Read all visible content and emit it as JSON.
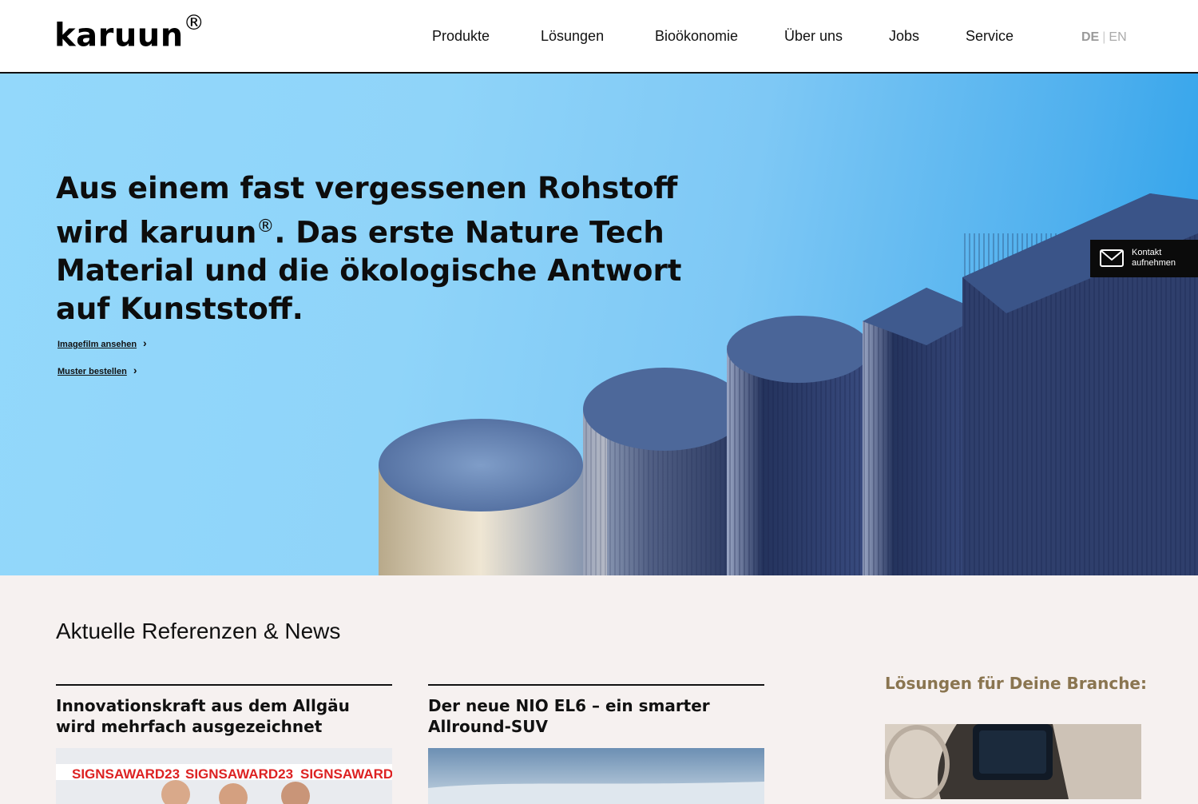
{
  "header": {
    "logo": "karuun",
    "logo_mark": "®",
    "nav": [
      "Produkte",
      "Lösungen",
      "Bioökonomie",
      "Über uns",
      "Jobs",
      "Service"
    ],
    "lang_active": "DE",
    "lang_sep": "|",
    "lang_other": "EN"
  },
  "hero": {
    "title_part1": "Aus einem fast vergessenen Rohstoff wird karuun",
    "title_mark": "®",
    "title_part2": ". Das erste Nature Tech Material und die ökologische Antwort auf Kunststoff.",
    "link1": "Imagefilm ansehen",
    "link2": "Muster bestellen",
    "contact_line1": "Kontakt",
    "contact_line2": "aufnehmen"
  },
  "news": {
    "title": "Aktuelle Referenzen & News",
    "cards": [
      {
        "title": "Innovationskraft aus dem Allgäu wird mehrfach ausgezeichnet",
        "award_text": "SIGNSAWARD23"
      },
      {
        "title": "Der neue NIO EL6 – ein smarter Allround-SUV"
      }
    ],
    "branch_title": "Lösungen für Deine Branche:"
  },
  "colors": {
    "accent_gold": "#8a7550",
    "hero_sky": "#8fd4f9",
    "background": "#f6f1f0"
  }
}
